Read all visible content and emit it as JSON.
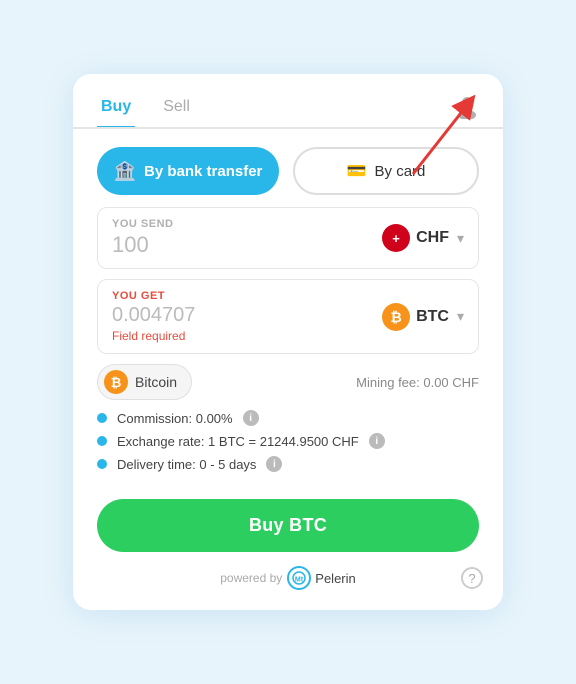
{
  "tabs": [
    {
      "label": "Buy",
      "active": true
    },
    {
      "label": "Sell",
      "active": false
    }
  ],
  "payment_methods": {
    "bank_label": "By bank transfer",
    "card_label": "By card"
  },
  "you_send": {
    "label": "YOU SEND",
    "value": "100",
    "currency_code": "CHF",
    "currency_symbol": "+"
  },
  "you_get": {
    "label": "YOU GET",
    "value": "0.004707",
    "currency_code": "BTC",
    "field_required": "Field required"
  },
  "coin": {
    "name": "Bitcoin",
    "mining_fee": "Mining fee: 0.00 CHF"
  },
  "info": {
    "commission": "Commission: 0.00%",
    "exchange_rate": "Exchange rate: 1 BTC = 21244.9500 CHF",
    "delivery_time": "Delivery time: 0 - 5 days"
  },
  "buy_button": "Buy BTC",
  "footer": {
    "powered_by": "powered by",
    "brand": "Mt\nPelerin"
  }
}
